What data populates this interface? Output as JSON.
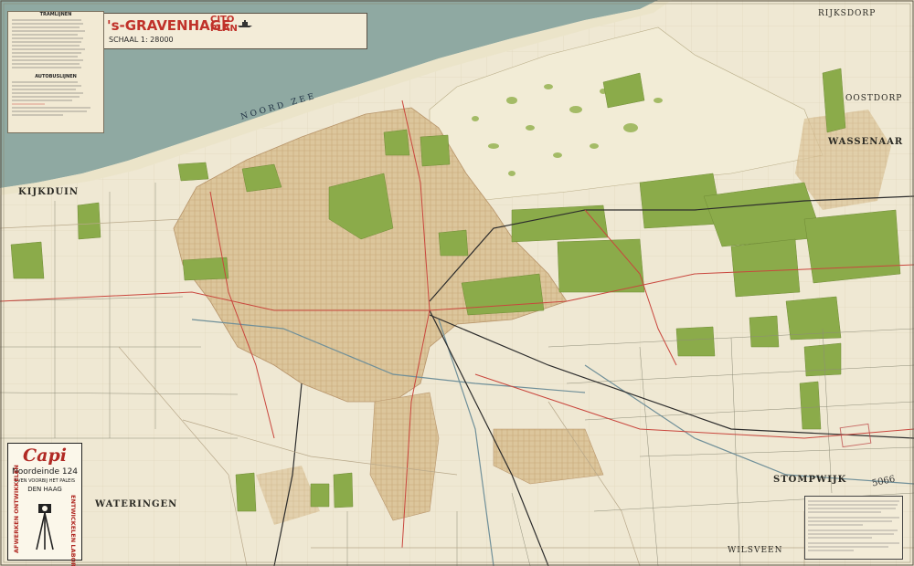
{
  "title": {
    "main": "'s-GRAVENHAGE",
    "cito": "CITO",
    "plan": "PLAN",
    "scale": "SCHAAL 1: 28000"
  },
  "sea": "NOORD ZEE",
  "places": [
    {
      "id": "kijkduin",
      "name": "KIJKDUIN"
    },
    {
      "id": "wassenaar",
      "name": "WASSENAAR"
    },
    {
      "id": "wateringen",
      "name": "WATERINGEN"
    },
    {
      "id": "stompwijk",
      "name": "STOMPWIJK"
    },
    {
      "id": "wilsveen",
      "name": "WILSVEEN"
    },
    {
      "id": "oostdorp",
      "name": "OOSTDORP"
    },
    {
      "id": "rijksdorp",
      "name": "RIJKSDORP"
    }
  ],
  "legend": {
    "tram_heading": "TRAMLIJNEN",
    "bus_heading": "AUTOBUSLIJNEN"
  },
  "ad": {
    "brand": "Capi",
    "address": "Noordeinde 124",
    "tagline": "EVEN VOORBIJ HET PALEIS",
    "city": "DEN HAAG",
    "left_vertical": "AFWERKEN ONTWIKKELEN",
    "right_vertical": "ENTWICKELEN LABORATORIES"
  },
  "annotation": "5066",
  "colors": {
    "sea": "#8fa9a2",
    "beach": "#ece5cc",
    "land": "#efe8d3",
    "green": "#8bab4a",
    "urban": "#ddc8a0",
    "road_red": "#c9463d",
    "title_red": "#c0322a"
  }
}
